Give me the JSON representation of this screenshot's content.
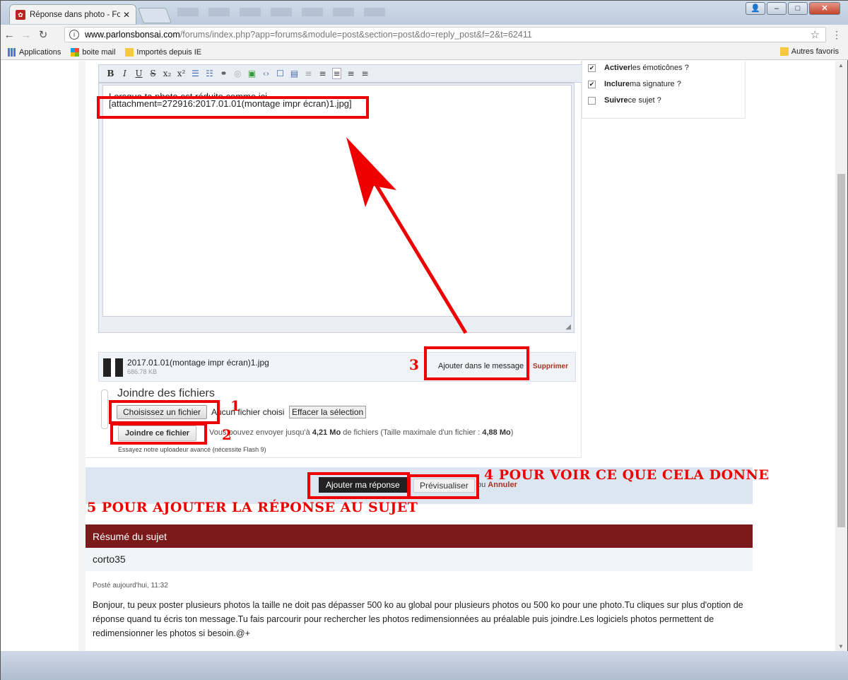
{
  "browser": {
    "tab_title": "Réponse dans photo - Fo",
    "tab_close": "✕",
    "url_host": "www.parlonsbonsai.com",
    "url_path": "/forums/index.php?app=forums&module=post&section=post&do=reply_post&f=2&t=62411",
    "bookmarks": [
      "Applications",
      "boite mail",
      "Importés depuis IE"
    ],
    "bookmarks_right": "Autres favoris"
  },
  "editor": {
    "toolbar": [
      "B",
      "I",
      "U",
      "S",
      "x₂",
      "x²",
      "☰",
      "☷",
      "⚭",
      "◎",
      "▣",
      "‹›",
      "☐",
      "▤",
      "≡",
      "≡",
      "≡",
      "≡",
      "≡"
    ],
    "text_line1": "Lorsque ta photo est réduite comme ici",
    "text_line2": "[attachment=272916:2017.01.01(montage impr écran)1.jpg]"
  },
  "attachment": {
    "filename": "2017.01.01(montage impr écran)1.jpg",
    "size": "686.78 KB",
    "add_label": "Ajouter dans le message",
    "delete_label": "Supprimer"
  },
  "upload": {
    "title": "Joindre des fichiers",
    "choose_label": "Choisissez un fichier",
    "no_file": "Aucun fichier choisi",
    "clear_label": "Effacer la sélection",
    "join_label": "Joindre ce fichier",
    "info_prefix": "Vous pouvez envoyer jusqu'à ",
    "info_total": "4,21 Mo",
    "info_mid": " de fichiers (Taille maximale d'un fichier : ",
    "info_max": "4,88 Mo",
    "info_suffix": ")",
    "flash_tip": "Essayez notre uploadeur avancé (nécessite Flash 9)"
  },
  "options": [
    {
      "bold": "Activer",
      "rest": " les émoticônes ?",
      "checked": true
    },
    {
      "bold": "Inclure",
      "rest": " ma signature ?",
      "checked": true
    },
    {
      "bold": "Suivre",
      "rest": " ce sujet ?",
      "checked": false
    }
  ],
  "submit": {
    "reply_label": "Ajouter ma réponse",
    "preview_label": "Prévisualiser",
    "or": "ou ",
    "cancel_label": "Annuler"
  },
  "summary": {
    "header": "Résumé du sujet",
    "user": "corto35",
    "date": "Posté aujourd'hui, 11:32",
    "body": "Bonjour, tu peux poster plusieurs photos la taille ne doit pas dépasser 500 ko au global pour plusieurs photos ou 500 ko pour une photo.Tu cliques sur plus d'option de réponse quand tu écris ton message.Tu fais parcourir pour rechercher les photos redimensionnées au préalable puis joindre.Les logiciels photos permettent de redimensionner les photos si besoin.@+"
  },
  "annotations": {
    "n1": "1",
    "n2": "2",
    "n3": "3",
    "step4": "4 POUR VOIR CE QUE CELA DONNE",
    "step5": "5 POUR AJOUTER LA RÉPONSE AU SUJET",
    "color": "#e00000"
  }
}
